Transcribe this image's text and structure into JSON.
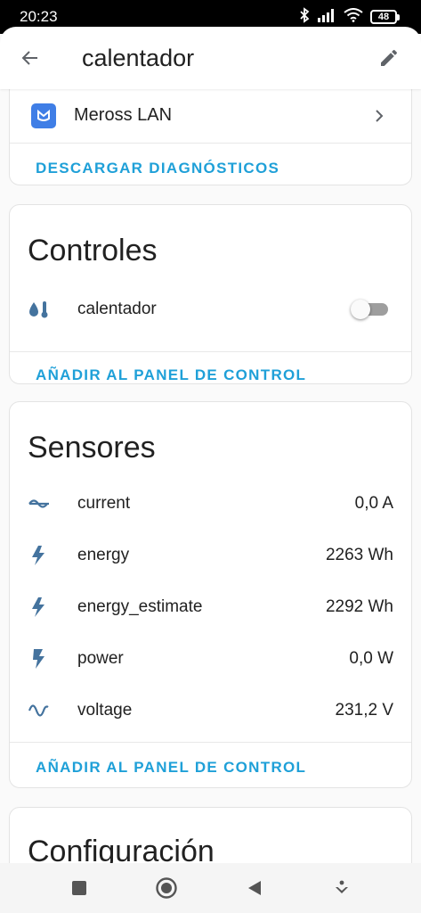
{
  "status_bar": {
    "time": "20:23",
    "battery": "48"
  },
  "header": {
    "title": "calentador"
  },
  "integration": {
    "label": "Meross LAN",
    "action": "DESCARGAR DIAGNÓSTICOS"
  },
  "controls": {
    "title": "Controles",
    "items": [
      {
        "label": "calentador",
        "icon": "thermometer-water-icon",
        "state": "off"
      }
    ],
    "action": "AÑADIR AL PANEL DE CONTROL"
  },
  "sensors": {
    "title": "Sensores",
    "items": [
      {
        "label": "current",
        "value": "0,0 A",
        "icon": "current-ac-icon"
      },
      {
        "label": "energy",
        "value": "2263 Wh",
        "icon": "flash-icon"
      },
      {
        "label": "energy_estimate",
        "value": "2292 Wh",
        "icon": "flash-icon"
      },
      {
        "label": "power",
        "value": "0,0 W",
        "icon": "flash-icon"
      },
      {
        "label": "voltage",
        "value": "231,2 V",
        "icon": "sine-wave-icon"
      }
    ],
    "action": "AÑADIR AL PANEL DE CONTROL"
  },
  "config": {
    "title": "Configuración"
  },
  "colors": {
    "accent": "#1fa0d8",
    "icon": "#44739e",
    "meross": "#3f7ee6"
  }
}
